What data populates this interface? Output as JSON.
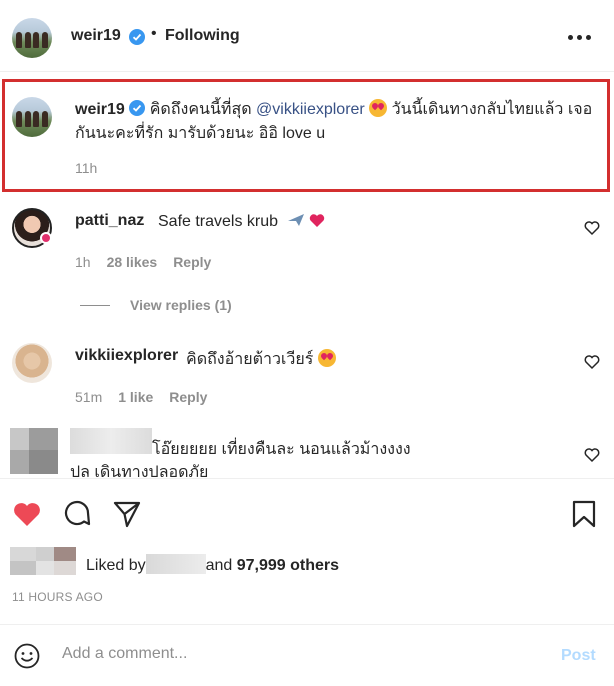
{
  "header": {
    "username": "weir19",
    "separator": "•",
    "follow_status": "Following"
  },
  "caption": {
    "username": "weir19",
    "text_before_mention": "คิดถึงคนนี้ที่สุด ",
    "mention": "@vikkiiexplorer",
    "text_after_emoji": " วันนี้เดินทางกลับไทยแล้ว เจอกันนะคะที่รัก มารับด้วยนะ อิอิ love u",
    "time": "11h"
  },
  "comments": [
    {
      "username": "patti_naz",
      "text": "Safe travels krub",
      "time": "1h",
      "likes": "28 likes",
      "reply": "Reply",
      "view_replies": "View replies (1)"
    },
    {
      "username": "vikkiiexplorer",
      "text": "คิดถึงอ้ายต้าวเวียร์",
      "time": "51m",
      "likes": "1 like",
      "reply": "Reply"
    },
    {
      "text": "โอ๊ยยยยย เที่ยงคืนละ นอนแล้วม้างงงง",
      "text2": "ปล เดินทางปลอดภัย"
    }
  ],
  "likes": {
    "prefix": "Liked by",
    "and": "and",
    "count": "97,999 others"
  },
  "posted": "11 HOURS AGO",
  "comment_box": {
    "placeholder": "Add a comment...",
    "post_label": "Post"
  },
  "colors": {
    "accent_red": "#ed4956",
    "verified_blue": "#3897f0",
    "link": "#385185",
    "highlight_border": "#d32f2f"
  },
  "icons": [
    "more-icon",
    "verified-icon",
    "heart-icon",
    "comment-icon",
    "share-icon",
    "bookmark-icon",
    "smile-icon",
    "airplane-icon"
  ]
}
